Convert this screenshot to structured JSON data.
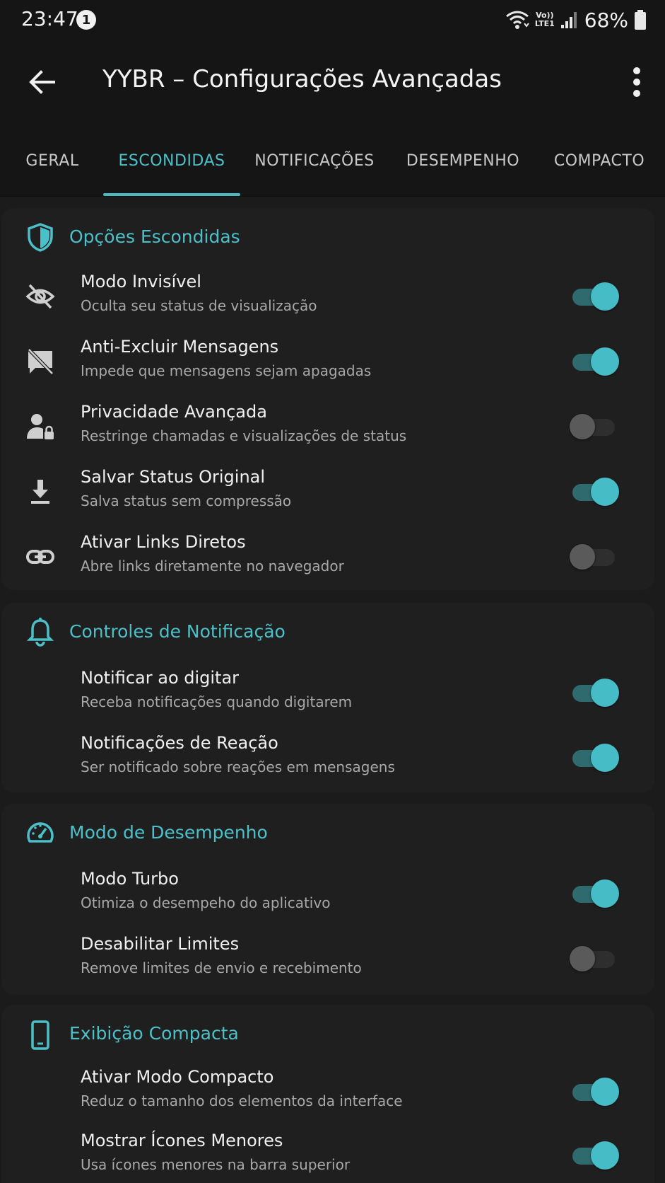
{
  "status_bar": {
    "time": "23:47",
    "notification_count": "1",
    "network_label_top": "Vo))",
    "network_label_bottom": "LTE1",
    "battery": "68%"
  },
  "app_bar": {
    "title": "YYBR – Configurações Avançadas",
    "back_icon": "arrow-back-icon",
    "menu_icon": "more-vert-icon"
  },
  "tabs": [
    {
      "label": "GERAL",
      "active": false
    },
    {
      "label": "ESCONDIDAS",
      "active": true
    },
    {
      "label": "NOTIFICAÇÕES",
      "active": false
    },
    {
      "label": "DESEMPENHO",
      "active": false
    },
    {
      "label": "COMPACTO",
      "active": false
    }
  ],
  "colors": {
    "accent": "#4cc0c8",
    "background": "#1b1b1b",
    "card": "#1f1f1f",
    "toggle_on": "#45bcc6",
    "toggle_off": "#5a5a5a"
  },
  "sections": [
    {
      "title": "Opções Escondidas",
      "icon": "shield-icon",
      "items": [
        {
          "title": "Modo Invisível",
          "subtitle": "Oculta seu status de visualização",
          "icon": "eye-off-icon",
          "enabled": true
        },
        {
          "title": "Anti-Excluir Mensagens",
          "subtitle": "Impede que mensagens sejam apagadas",
          "icon": "message-off-icon",
          "enabled": true
        },
        {
          "title": "Privacidade Avançada",
          "subtitle": "Restringe chamadas e visualizações de status",
          "icon": "person-lock-icon",
          "enabled": false
        },
        {
          "title": "Salvar Status Original",
          "subtitle": "Salva status sem compressão",
          "icon": "download-icon",
          "enabled": true
        },
        {
          "title": "Ativar Links Diretos",
          "subtitle": "Abre links diretamente no navegador",
          "icon": "link-icon",
          "enabled": false
        }
      ]
    },
    {
      "title": "Controles de Notificação",
      "icon": "bell-icon",
      "items": [
        {
          "title": "Notificar ao digitar",
          "subtitle": "Receba notificações quando digitarem",
          "enabled": true
        },
        {
          "title": "Notificações de Reação",
          "subtitle": "Ser notificado sobre reações em mensagens",
          "enabled": true
        }
      ]
    },
    {
      "title": "Modo de Desempenho",
      "icon": "speedometer-icon",
      "items": [
        {
          "title": "Modo Turbo",
          "subtitle": "Otimiza o desempeho do aplicativo",
          "enabled": true
        },
        {
          "title": "Desabilitar Limites",
          "subtitle": "Remove limites de envio e recebimento",
          "enabled": false
        }
      ]
    },
    {
      "title": "Exibição Compacta",
      "icon": "phone-icon",
      "items": [
        {
          "title": "Ativar Modo Compacto",
          "subtitle": "Reduz o tamanho dos elementos da interface",
          "enabled": true
        },
        {
          "title": "Mostrar Ícones Menores",
          "subtitle": "Usa ícones menores na barra superior",
          "enabled": true
        }
      ]
    }
  ]
}
